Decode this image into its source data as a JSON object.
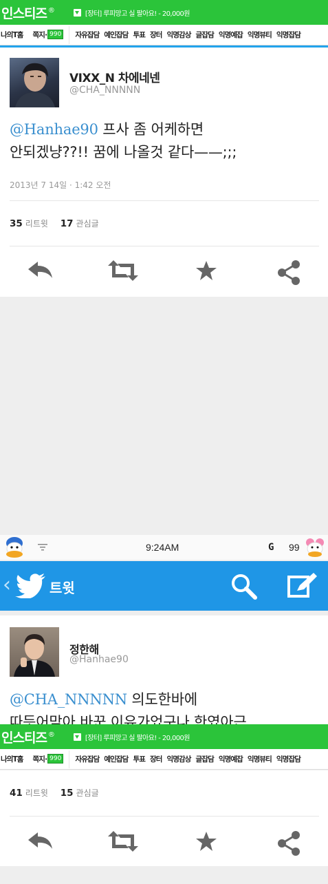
{
  "banner": {
    "logo": "인스티즈",
    "reg": "®",
    "notice": "[장터] 루피망고 실 팔아요! - 20,000원"
  },
  "nav": {
    "my": "나의T홈",
    "msg": "쪽지·",
    "badge": "990",
    "links": [
      "자유잡담",
      "예인잡담",
      "투표",
      "장터",
      "익명감상",
      "글잡담",
      "익명예잡",
      "익명뷰티",
      "익명잡담"
    ]
  },
  "tweet1": {
    "name": "VIXX_N 차에네넨",
    "handle": "@CHA_NNNNN",
    "mention": "@Hanhae90",
    "text_a": " 프사 좀 어케하면",
    "text_b": "안되겠냥??!! 꿈에 나올것 같다——;;;",
    "time": "2013년 7 14일 · 1:42 오전",
    "retweets": "35",
    "retweets_label": "리트윗",
    "favs": "17",
    "favs_label": "관심글"
  },
  "statusbar": {
    "time": "9:24AM",
    "g": "G",
    "battery": "99"
  },
  "twitter_bar": {
    "back": "‹",
    "title": "트윗"
  },
  "tweet2": {
    "name": "정한해",
    "handle": "@Hanhae90",
    "mention": "@CHA_NNNNN",
    "text_a": " 의도한바에",
    "text_b": "따듯어맞아 바꾼 이유가었구나 한였아근",
    "retweets": "41",
    "retweets_label": "리트윗",
    "favs": "15",
    "favs_label": "관심글"
  },
  "icons": {
    "reply": "reply-icon",
    "retweet": "retweet-icon",
    "favorite": "star-icon",
    "share": "share-icon",
    "search": "search-icon",
    "compose": "compose-icon"
  },
  "colors": {
    "instiz_green": "#2bc43a",
    "twitter_blue": "#1f96e6",
    "mention": "#3a8fcf"
  }
}
